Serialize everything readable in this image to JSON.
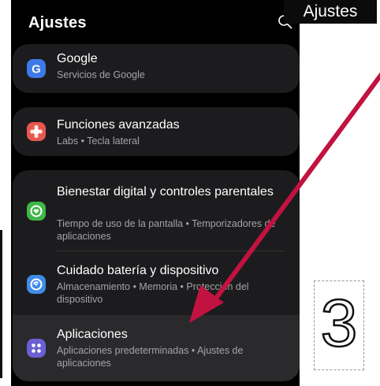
{
  "header": {
    "title": "Ajustes"
  },
  "tag": {
    "label": "Ajustes"
  },
  "items": [
    {
      "title": "Google",
      "subtitle": "Servicios de Google",
      "icon": "google-icon",
      "color": "#3d7ae9"
    },
    {
      "title": "Funciones avanzadas",
      "subtitle": "Labs • Tecla lateral",
      "icon": "advanced-features-icon",
      "color": "#e8574f"
    },
    {
      "title": "Bienestar digital y controles parentales",
      "subtitle": "Tiempo de uso de la pantalla • Temporizadores de aplicaciones",
      "icon": "digital-wellbeing-icon",
      "color": "#3fb747"
    },
    {
      "title": "Cuidado batería y dispositivo",
      "subtitle": "Almacenamiento • Memoria • Protección del dispositivo",
      "icon": "device-care-icon",
      "color": "#3f8be8"
    },
    {
      "title": "Aplicaciones",
      "subtitle": "Aplicaciones predeterminadas • Ajustes de aplicaciones",
      "icon": "apps-icon",
      "color": "#6a5fd4"
    }
  ],
  "step_number": "3",
  "colors": {
    "arrow": "#c2123f",
    "card_bg": "#1c1c1e",
    "highlight_bg": "#2a2a2d"
  }
}
